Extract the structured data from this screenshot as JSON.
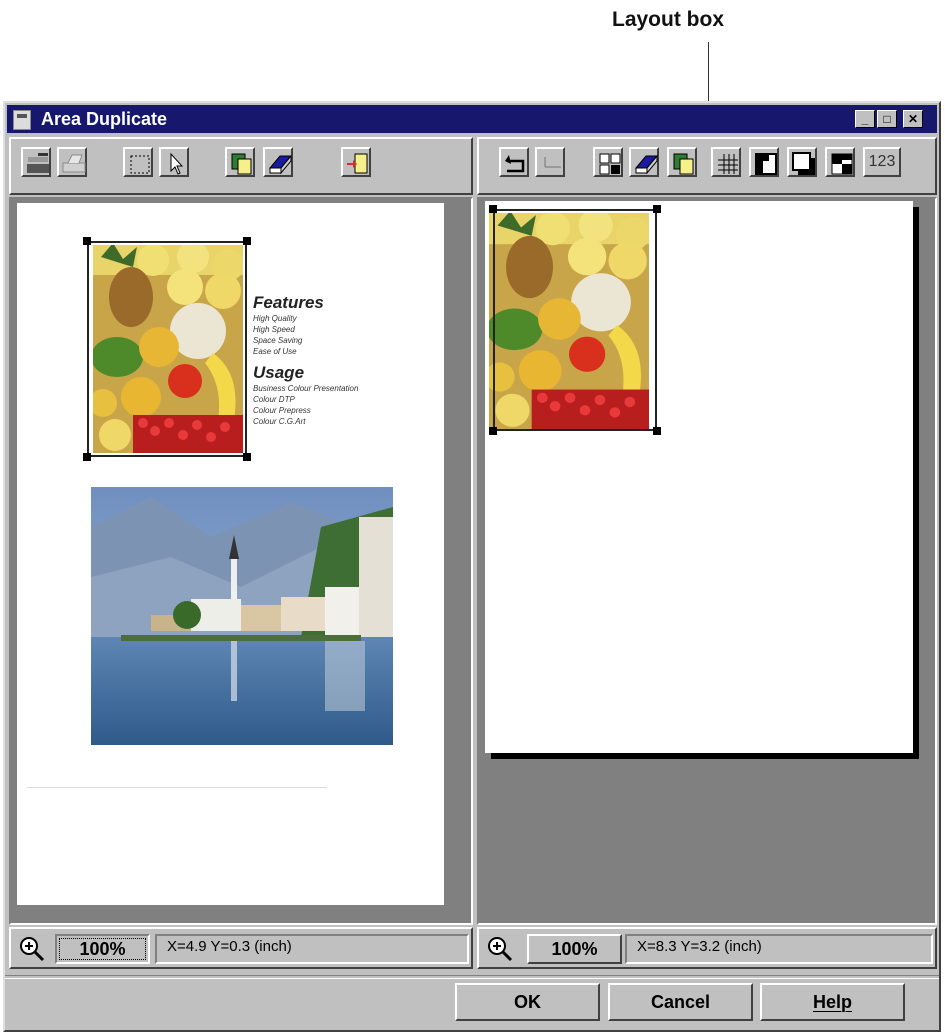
{
  "annotation": {
    "label": "Layout box"
  },
  "window": {
    "title": "Area Duplicate",
    "controls": {
      "minimize": "_",
      "maximize": "□",
      "close": "✕"
    }
  },
  "left_toolbar": {
    "icons": [
      "scanner-icon",
      "printer-icon",
      "marquee-select-icon",
      "pointer-arrow-icon",
      "copy-icon",
      "eraser-icon",
      "import-icon"
    ]
  },
  "right_toolbar": {
    "icons": [
      "undo-icon",
      "redo-icon",
      "arrange-icon",
      "eraser-icon",
      "copy-icon",
      "grid-icon",
      "flip-icon",
      "shadow-icon",
      "checker-icon"
    ],
    "numbering_label": "123"
  },
  "left_document": {
    "features_title": "Features",
    "features_items": [
      "High Quality",
      "High Speed",
      "Space Saving",
      "Ease of Use"
    ],
    "usage_title": "Usage",
    "usage_items": [
      "Business Colour Presentation",
      "Colour DTP",
      "Colour Prepress",
      "Colour C.G.Art"
    ]
  },
  "left_status": {
    "zoom": "100%",
    "coords": "X=4.9 Y=0.3 (inch)"
  },
  "right_status": {
    "zoom": "100%",
    "coords": "X=8.3 Y=3.2 (inch)"
  },
  "buttons": {
    "ok": "OK",
    "cancel": "Cancel",
    "help": "Help"
  },
  "colors": {
    "titlebar": "#17176e",
    "face": "#c0c0c0",
    "canvas": "#808080"
  }
}
